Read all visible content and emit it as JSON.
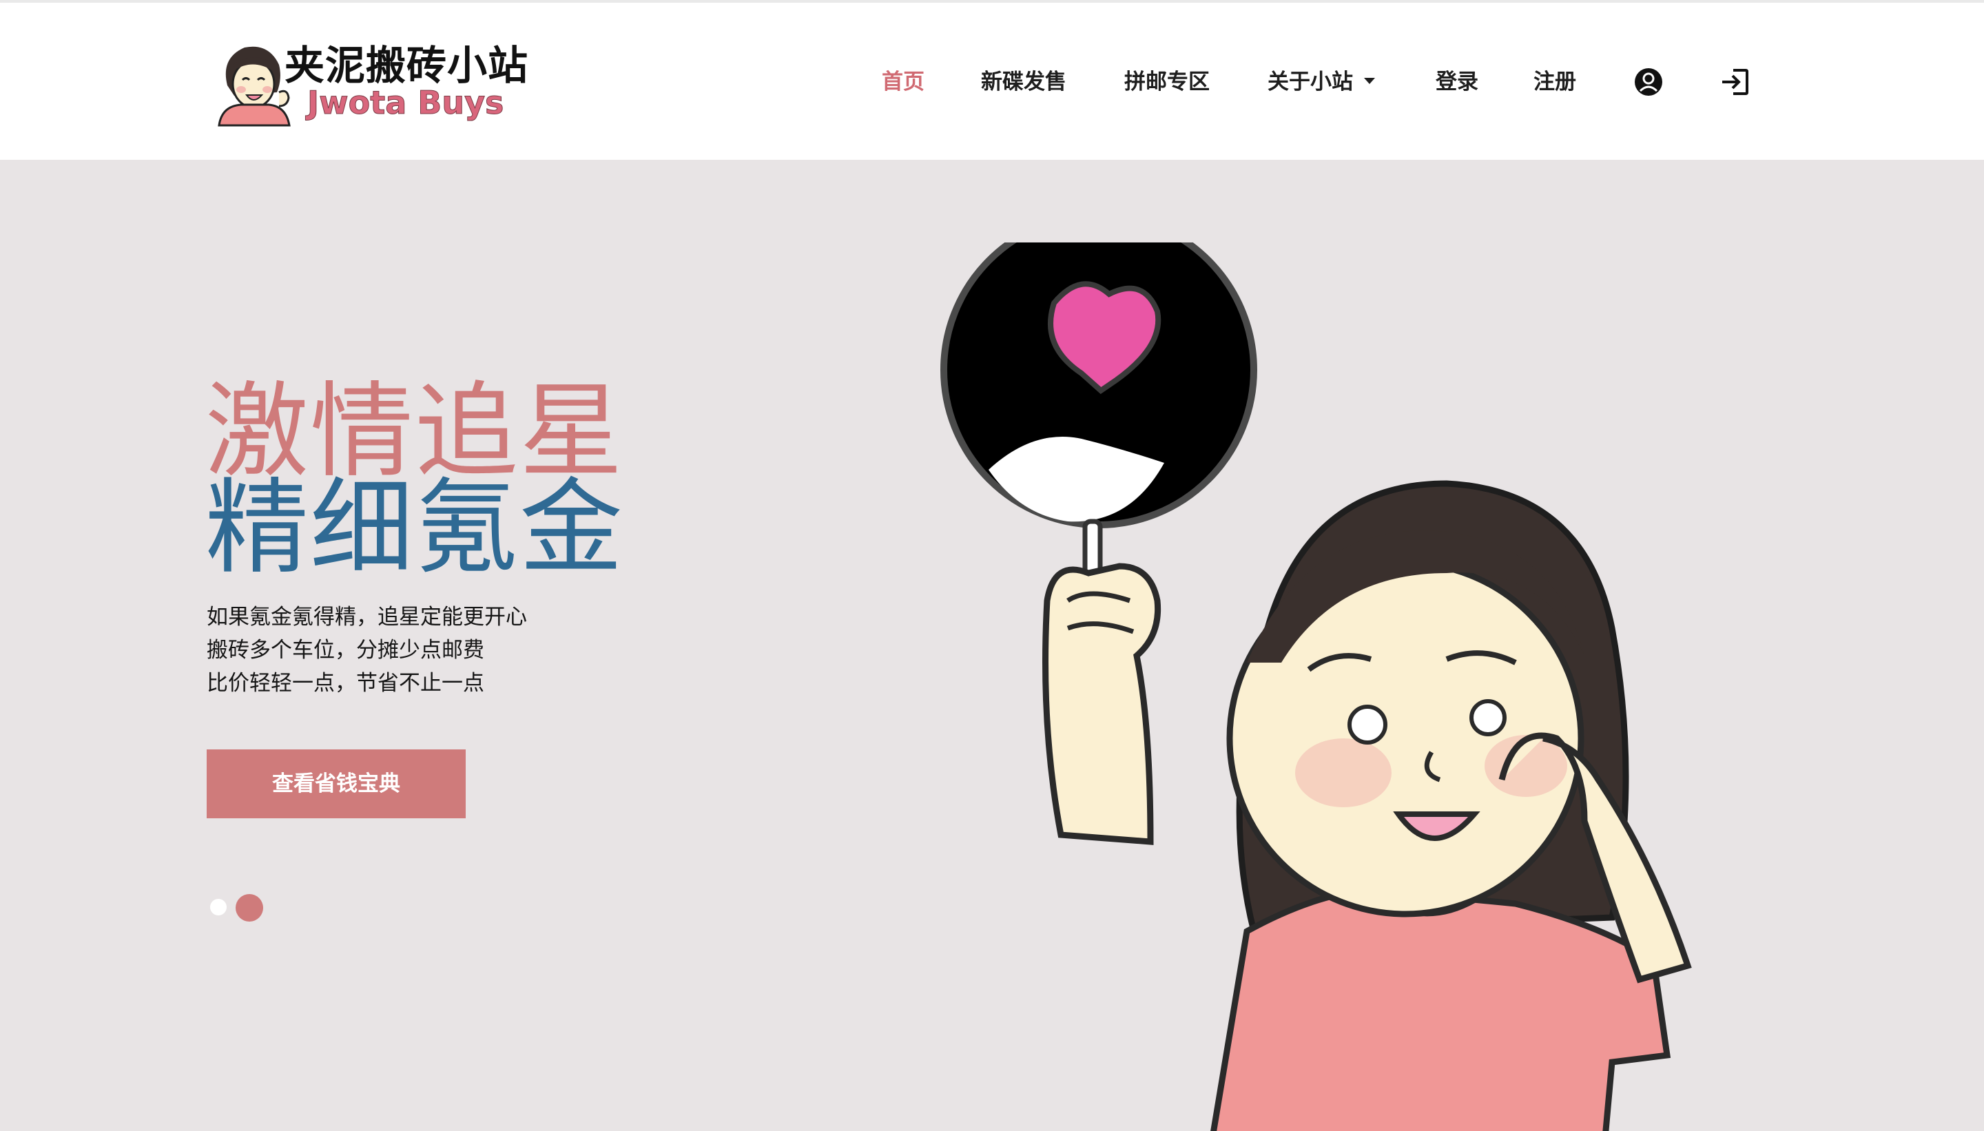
{
  "logo": {
    "title_cn": "夹泥搬砖小站",
    "title_en": "Jwota Buys"
  },
  "nav": {
    "items": [
      {
        "label": "首页",
        "active": true
      },
      {
        "label": "新碟发售"
      },
      {
        "label": "拼邮专区"
      },
      {
        "label": "关于小站",
        "has_dropdown": true
      },
      {
        "label": "登录"
      },
      {
        "label": "注册"
      }
    ],
    "icons": [
      "user-circle-icon",
      "sign-in-icon"
    ]
  },
  "hero": {
    "headline_line1": "激情追星",
    "headline_line2": "精细氪金",
    "sub_lines": [
      "如果氪金氪得精，追星定能更开心",
      "搬砖多个车位，分摊少点邮费",
      "比价轻轻一点，节省不止一点"
    ],
    "cta_label": "查看省钱宝典",
    "carousel": {
      "count": 2,
      "active_index": 1
    }
  },
  "colors": {
    "accent_pink": "#cf7b7b",
    "accent_blue": "#2f6a94",
    "hero_bg": "#e8e4e5",
    "nav_active": "#d06a72"
  }
}
